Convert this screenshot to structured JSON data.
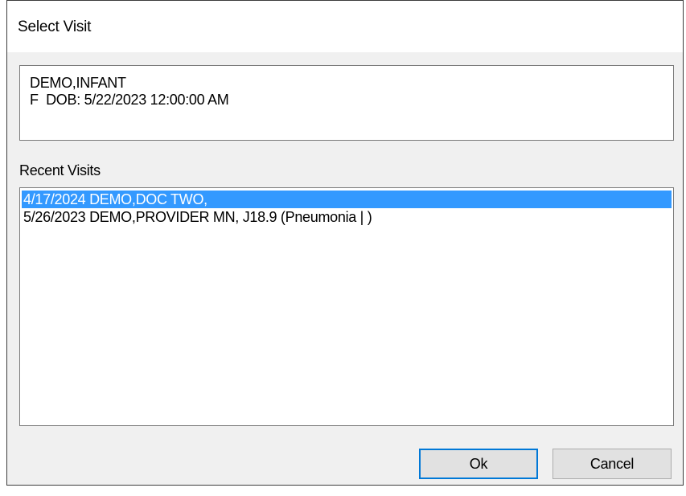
{
  "window": {
    "title": "Select Visit"
  },
  "patient": {
    "name": "DEMO,INFANT",
    "details": "F  DOB: 5/22/2023 12:00:00 AM"
  },
  "recent_visits": {
    "label": "Recent Visits",
    "items": [
      {
        "text": "4/17/2024 DEMO,DOC TWO,",
        "selected": true
      },
      {
        "text": "5/26/2023 DEMO,PROVIDER MN, J18.9 (Pneumonia | )",
        "selected": false
      }
    ]
  },
  "buttons": {
    "ok_label": "Ok",
    "cancel_label": "Cancel"
  },
  "colors": {
    "selection": "#3399ff",
    "focus_border": "#0078d7",
    "dialog_bg": "#f0f0f0"
  }
}
